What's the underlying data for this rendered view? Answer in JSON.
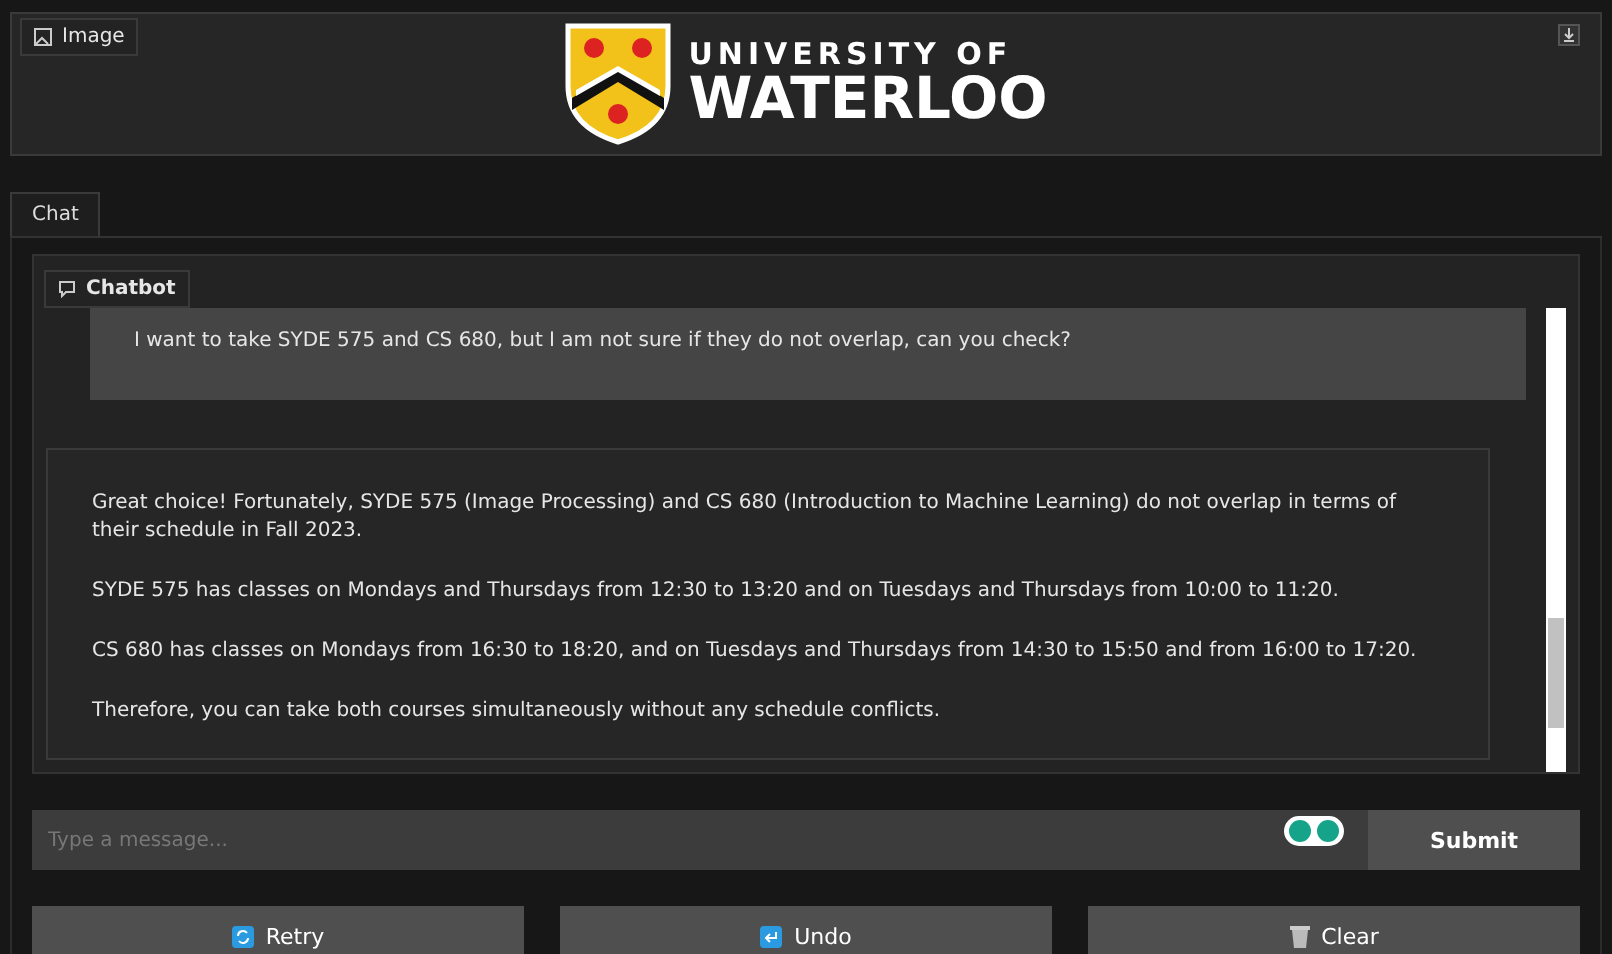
{
  "image_panel": {
    "label": "Image",
    "logo": {
      "line_1": "UNIVERSITY OF",
      "line_2": "WATERLOO"
    }
  },
  "tabs": [
    {
      "label": "Chat",
      "selected": true
    }
  ],
  "chatbot": {
    "label": "Chatbot",
    "messages": [
      {
        "kind": "user",
        "paragraphs": [
          "I want to take SYDE 575 and CS 680, but I am not sure if they do not overlap, can you check?"
        ]
      },
      {
        "kind": "bot",
        "paragraphs": [
          "Great choice! Fortunately, SYDE 575 (Image Processing) and CS 680 (Introduction to Machine Learning) do not overlap in terms of their schedule in Fall 2023.",
          "SYDE 575 has classes on Mondays and Thursdays from 12:30 to 13:20 and on Tuesdays and Thursdays from 10:00 to 11:20.",
          "CS 680 has classes on Mondays from 16:30 to 18:20, and on Tuesdays and Thursdays from 14:30 to 15:50 and from 16:00 to 17:20.",
          "Therefore, you can take both courses simultaneously without any schedule conflicts."
        ]
      }
    ]
  },
  "input": {
    "placeholder": "Type a message..."
  },
  "submit": "Submit",
  "actions": [
    {
      "kind": "retry",
      "label": "Retry"
    },
    {
      "kind": "undo",
      "label": "Undo"
    },
    {
      "kind": "clear",
      "label": "Clear"
    }
  ]
}
